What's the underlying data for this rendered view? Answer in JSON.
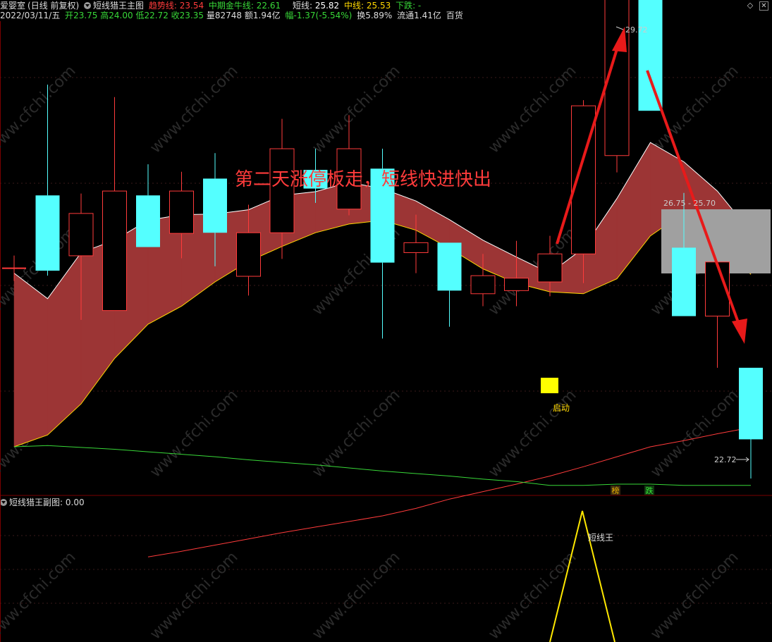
{
  "header": {
    "app": "爱婴室",
    "mode": "(日线 前复权)",
    "indicator_main": "短线猎王主图",
    "trend_label": "趋势线: ",
    "trend_value": "23.54",
    "mid_bull_label": "中期金牛线: ",
    "mid_bull_value": "22.61",
    "short_label": "短线: ",
    "short_value": "25.82",
    "mid_label": "中线: ",
    "mid_value": "25.53",
    "down_label": "下跌: -",
    "colors": {
      "trend": "#ff3b3b",
      "mid_bull": "#38d838",
      "short": "#ffffff",
      "mid": "#ffd800",
      "down": "#38d838"
    }
  },
  "quote": {
    "date": "2022/03/11/五",
    "open_label": "开",
    "open": "23.75",
    "high_label": "高",
    "high": "24.00",
    "low_label": "低",
    "low": "22.72",
    "close_label": "收",
    "close": "23.35",
    "vol_label": "量",
    "vol": "82748",
    "amt_label": "额",
    "amt": "1.94亿",
    "chg_label": "幅",
    "chg": "-1.37(-5.54%)",
    "turn_label": "换",
    "turn": "5.89%",
    "float_label": "流通",
    "float": "1.41亿",
    "sector": "百货"
  },
  "sub": {
    "title": "短线猎王副图",
    "value": ": 0.00",
    "signal_label": "短线王"
  },
  "watermark": "www.cfchi.com",
  "chart_data": [
    {
      "type": "candlestick",
      "title": "短线猎王主图",
      "y_range": [
        22,
        31
      ],
      "up_color": "#ff3b3b",
      "down_color": "#54ffff",
      "candles": [
        {
          "o": 26.1,
          "h": 26.1,
          "l": 26.1,
          "c": 26.1
        },
        {
          "o": 27.27,
          "h": 29.05,
          "l": 25.98,
          "c": 26.06
        },
        {
          "o": 26.3,
          "h": 27.3,
          "l": 25.27,
          "c": 26.98
        },
        {
          "o": 25.42,
          "h": 28.85,
          "l": 25.42,
          "c": 27.34
        },
        {
          "o": 27.27,
          "h": 27.77,
          "l": 26.67,
          "c": 26.44
        },
        {
          "o": 26.66,
          "h": 27.65,
          "l": 26.26,
          "c": 27.34
        },
        {
          "o": 27.54,
          "h": 27.95,
          "l": 26.13,
          "c": 26.67
        },
        {
          "o": 25.97,
          "h": 27.12,
          "l": 25.66,
          "c": 26.67
        },
        {
          "o": 26.67,
          "h": 28.5,
          "l": 26.25,
          "c": 28.02
        },
        {
          "o": 27.68,
          "h": 28.02,
          "l": 27.15,
          "c": 27.38
        },
        {
          "o": 27.05,
          "h": 28.56,
          "l": 26.95,
          "c": 28.02
        },
        {
          "o": 27.7,
          "h": 28.02,
          "l": 24.97,
          "c": 26.19
        },
        {
          "o": 26.35,
          "h": 26.96,
          "l": 26.02,
          "c": 26.51
        },
        {
          "o": 26.51,
          "h": 26.51,
          "l": 25.16,
          "c": 25.74
        },
        {
          "o": 25.69,
          "h": 26.33,
          "l": 25.49,
          "c": 25.98
        },
        {
          "o": 25.74,
          "h": 26.54,
          "l": 25.49,
          "c": 25.94
        },
        {
          "o": 25.88,
          "h": 26.62,
          "l": 25.65,
          "c": 26.33
        },
        {
          "o": 26.33,
          "h": 28.8,
          "l": 25.86,
          "c": 28.71
        },
        {
          "o": 27.91,
          "h": 31.12,
          "l": 27.64,
          "c": 31.06
        },
        {
          "o": 30.7,
          "h": 30.7,
          "l": 28.63,
          "c": 28.63
        },
        {
          "o": 26.43,
          "h": 27.31,
          "l": 25.33,
          "c": 25.33
        },
        {
          "o": 25.33,
          "h": 26.2,
          "l": 24.5,
          "c": 26.2
        },
        {
          "o": 24.5,
          "h": 24.5,
          "l": 22.72,
          "c": 23.35
        }
      ],
      "lines": [
        {
          "name": "短线",
          "color": "#ffffff",
          "values": [
            26.02,
            25.61,
            26.35,
            26.55,
            26.87,
            26.96,
            26.97,
            27.04,
            27.27,
            27.33,
            27.48,
            27.38,
            27.18,
            26.88,
            26.55,
            26.28,
            26.02,
            26.42,
            27.22,
            28.12,
            27.81,
            27.34,
            26.68
          ]
        },
        {
          "name": "中线",
          "color": "#ffd800",
          "values": [
            23.23,
            23.42,
            23.92,
            24.65,
            25.2,
            25.49,
            25.88,
            26.21,
            26.45,
            26.67,
            26.81,
            26.87,
            26.71,
            26.42,
            26.09,
            25.86,
            25.72,
            25.69,
            25.93,
            26.62,
            26.99,
            26.55,
            26.0
          ]
        },
        {
          "name": "趋势线",
          "color": "#ff3b3b",
          "values": [
            null,
            null,
            null,
            null,
            21.46,
            21.55,
            21.65,
            21.75,
            21.85,
            21.94,
            22.03,
            22.12,
            22.24,
            22.39,
            22.51,
            22.63,
            22.76,
            22.91,
            23.07,
            23.23,
            23.33,
            23.44,
            23.54
          ]
        },
        {
          "name": "中期金牛线",
          "color": "#38d838",
          "values": [
            23.23,
            23.25,
            23.22,
            23.19,
            23.15,
            23.11,
            23.07,
            23.02,
            22.98,
            22.94,
            22.89,
            22.84,
            22.8,
            22.76,
            22.71,
            22.67,
            22.61,
            22.61,
            22.63,
            22.63,
            22.61,
            22.61,
            22.61
          ]
        }
      ],
      "annotations": [
        {
          "text": "第二天涨停板走，短线快进快出",
          "color": "#ff3b3b"
        },
        {
          "text": "29.72",
          "label": "high"
        },
        {
          "text": "26.75 - 25.70",
          "label": "zone"
        },
        {
          "text": "22.72",
          "label": "low"
        },
        {
          "text": "启动",
          "label": "signal"
        },
        {
          "text": "榜",
          "label": "tag"
        },
        {
          "text": "跌",
          "label": "tag"
        }
      ]
    },
    {
      "type": "line",
      "title": "短线猎王副图",
      "series": [
        {
          "color": "#ffe800",
          "values": [
            0,
            1,
            0
          ]
        }
      ]
    }
  ]
}
